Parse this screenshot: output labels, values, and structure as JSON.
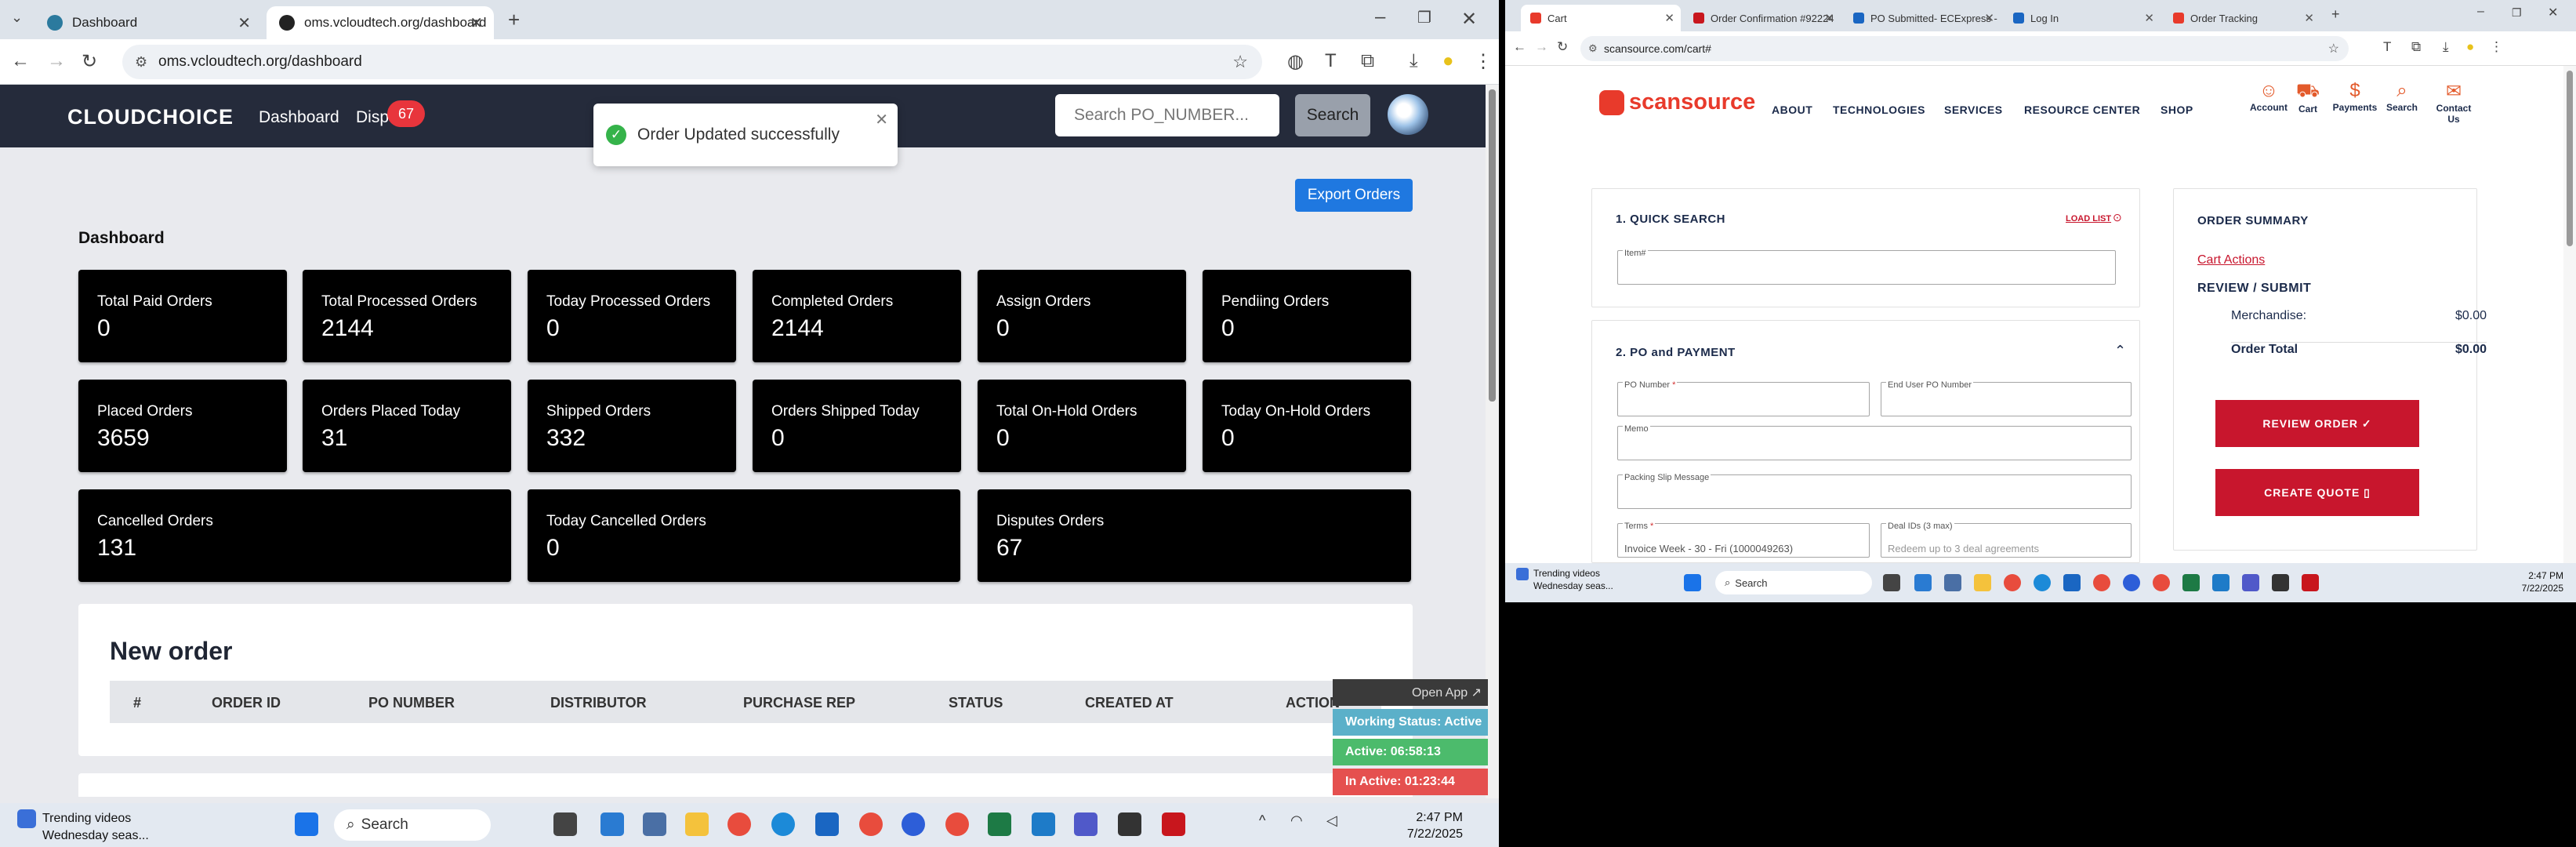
{
  "left_browser": {
    "tabs": [
      {
        "title": "Dashboard",
        "active": false
      },
      {
        "title": "oms.vcloudtech.org/dashboard",
        "active": true
      }
    ],
    "url": "oms.vcloudtech.org/dashboard"
  },
  "app": {
    "logo": "CLOUDCHOICE",
    "nav": {
      "dashboard": "Dashboard",
      "disputes": "Dispu",
      "disputes_badge": "67"
    },
    "search_placeholder": "Search PO_NUMBER...",
    "search_button": "Search",
    "toast": "Order Updated successfully",
    "export_button": "Export Orders",
    "dashboard_title": "Dashboard",
    "cards": [
      {
        "label": "Total Paid Orders",
        "value": "0"
      },
      {
        "label": "Total Processed Orders",
        "value": "2144"
      },
      {
        "label": "Today Processed Orders",
        "value": "0"
      },
      {
        "label": "Completed Orders",
        "value": "2144"
      },
      {
        "label": "Assign Orders",
        "value": "0"
      },
      {
        "label": "Pendiing Orders",
        "value": "0"
      },
      {
        "label": "Placed Orders",
        "value": "3659"
      },
      {
        "label": "Orders Placed Today",
        "value": "31"
      },
      {
        "label": "Shipped Orders",
        "value": "332"
      },
      {
        "label": "Orders Shipped Today",
        "value": "0"
      },
      {
        "label": "Total On-Hold Orders",
        "value": "0"
      },
      {
        "label": "Today On-Hold Orders",
        "value": "0"
      },
      {
        "label": "Cancelled Orders",
        "value": "131"
      },
      {
        "label": "Today Cancelled Orders",
        "value": "0"
      },
      {
        "label": "Disputes Orders",
        "value": "67"
      }
    ],
    "new_order": {
      "title": "New order",
      "columns": [
        "#",
        "ORDER ID",
        "PO NUMBER",
        "DISTRIBUTOR",
        "PURCHASE REP",
        "STATUS",
        "CREATED AT",
        "ACTION"
      ]
    }
  },
  "status_widget": {
    "open_app": "Open App ↗",
    "working_status": "Working Status: Active",
    "active": "Active: 06:58:13",
    "inactive": "In Active: 01:23:44",
    "colors": {
      "working": "#5bb0c9",
      "active": "#4cbb6c",
      "inactive": "#e5504f"
    }
  },
  "left_taskbar": {
    "trending_title": "Trending videos",
    "trending_sub": "Wednesday seas...",
    "search": "Search",
    "time": "2:47 PM",
    "date": "7/22/2025"
  },
  "right_browser": {
    "tabs": [
      "Cart",
      "Order Confirmation #92224",
      "PO Submitted- ECExpress -",
      "Log In",
      "Order Tracking"
    ],
    "url": "scansource.com/cart#"
  },
  "scansource": {
    "logo": "scansource",
    "nav": [
      "ABOUT",
      "TECHNOLOGIES",
      "SERVICES",
      "RESOURCE CENTER",
      "SHOP"
    ],
    "icons": [
      "Account",
      "Cart",
      "Payments",
      "Search",
      "Contact Us"
    ],
    "quick_search": {
      "title": "1. QUICK SEARCH",
      "load_list": "LOAD LIST",
      "item_label": "Item#"
    },
    "po_payment": {
      "title": "2. PO and PAYMENT",
      "po_number": "PO Number",
      "end_user_po": "End User PO Number",
      "memo": "Memo",
      "packing_slip": "Packing Slip Message",
      "terms": "Terms",
      "terms_value": "Invoice Week - 30 - Fri (1000049263)",
      "deal_ids": "Deal IDs (3 max)",
      "deal_placeholder": "Redeem up to 3 deal agreements"
    },
    "summary": {
      "title": "ORDER SUMMARY",
      "cart_actions": "Cart Actions",
      "review_submit": "REVIEW / SUBMIT",
      "merch_label": "Merchandise:",
      "merch_value": "$0.00",
      "total_label": "Order Total",
      "total_value": "$0.00",
      "review_button": "REVIEW ORDER ✓",
      "quote_button": "CREATE QUOTE ▯"
    }
  },
  "right_taskbar": {
    "trending_title": "Trending videos",
    "trending_sub": "Wednesday seas...",
    "search": "Search",
    "time": "2:47 PM",
    "date": "7/22/2025"
  }
}
